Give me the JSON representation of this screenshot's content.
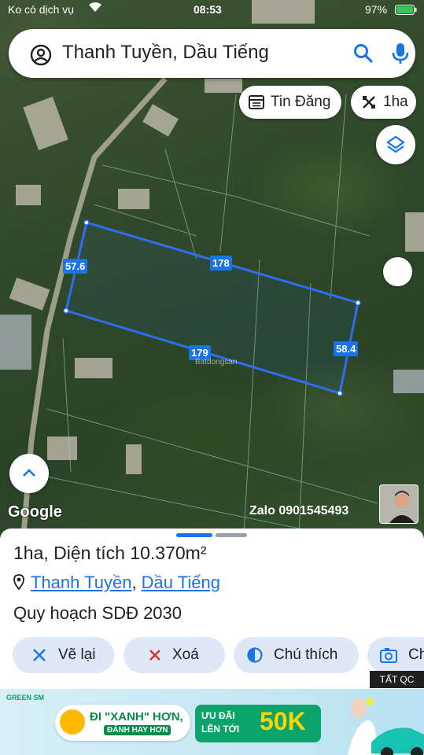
{
  "status_bar": {
    "carrier": "Ko có dịch vụ",
    "time": "08:53",
    "battery": "97%"
  },
  "search": {
    "query": "Thanh Tuyền, Dầu Tiếng"
  },
  "chips": {
    "listings": "Tin Đăng",
    "measure": "1ha"
  },
  "map": {
    "edges": {
      "top": "178",
      "bottom": "179",
      "left": "57.6",
      "right": "58.4"
    },
    "watermark": "Batdongsan",
    "google_logo": "Google",
    "zalo": "Zalo 0901545493"
  },
  "sheet": {
    "area_short": "1ha",
    "area_label": "Diện tích 10.370m²",
    "location_ward": "Thanh Tuyền",
    "location_district": "Dầu Tiếng",
    "planning": "Quy hoạch SDĐ 2030",
    "buttons": {
      "redraw": "Vẽ lại",
      "delete": "Xoá",
      "legend": "Chú thích",
      "capture": "Ch"
    }
  },
  "ad": {
    "tag": "TẤT QC",
    "brand": "GREEN SM",
    "slogan_1": "ĐI \"XANH\" HƠN,",
    "slogan_2": "ĐÁNH HAY HƠN",
    "promo_1": "ƯU ĐÃI",
    "promo_2": "LÊN TỚI",
    "promo_value": "50K"
  },
  "colors": {
    "accent": "#1a73e8",
    "chip_bg": "#dfe8f7"
  }
}
